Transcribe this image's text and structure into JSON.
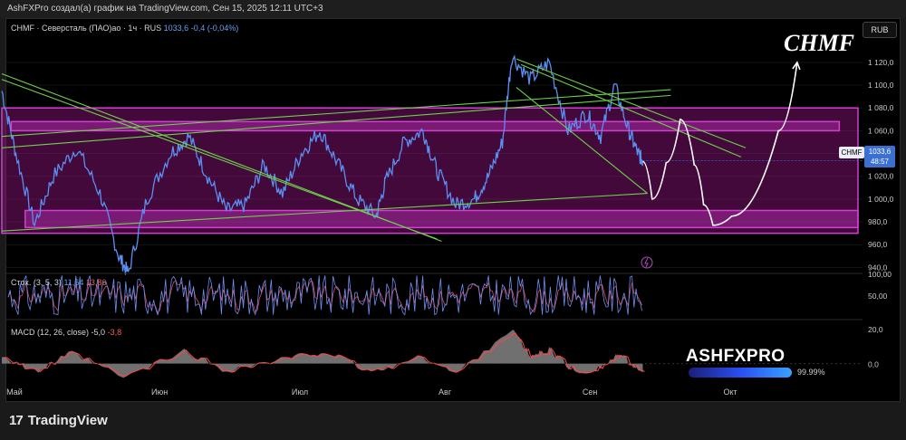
{
  "header": {
    "attribution": "AshFXPro создал(а) график на TradingView.com, Сен 15, 2025 12:11 UTC+3"
  },
  "legend": {
    "symbol": "CHMF · Северсталь (ПАО)ао · 1ч · RUS",
    "last": "1033,6",
    "change": "-0,4 (-0,04%)"
  },
  "currency_button": "RUB",
  "price_label": {
    "symbol": "CHMF",
    "price": "1033,6",
    "countdown": "48:57"
  },
  "annotation": "CHMF",
  "stoch_legend": {
    "name": "Стох. (3, 5, 3)",
    "k": "11,64",
    "d": "13,86"
  },
  "macd_legend": {
    "name": "MACD (12, 26, close)",
    "macd": "-5,0",
    "signal": "-3,8"
  },
  "watermark": {
    "brand": "ASHFXPRO",
    "progress_label": "99.99%",
    "progress": 0.9999
  },
  "footer_brand": "TradingView",
  "colors": {
    "price_line": "#5b8ff2",
    "zone": "#d23fd2",
    "trendline": "#6cd24a",
    "stoch_k": "#6b8ff0",
    "stoch_d": "#e04a6a",
    "macd_area": "#8a8a8a",
    "macd_signal": "#ff4444",
    "background": "#000000"
  },
  "chart_data": [
    {
      "type": "line",
      "title": "CHMF · Северсталь (ПАО)ао · 1ч · RUS",
      "x_ticks": [
        "Май",
        "Июн",
        "Июл",
        "Авг",
        "Сен",
        "Окт"
      ],
      "y_ticks": [
        940,
        960,
        980,
        1000,
        1020,
        1040,
        1060,
        1080,
        1100,
        1120
      ],
      "ylim": [
        930,
        1135
      ],
      "anchors": [
        [
          "2025-05-01",
          1095
        ],
        [
          "2025-05-04",
          1040
        ],
        [
          "2025-05-08",
          978
        ],
        [
          "2025-05-12",
          1020
        ],
        [
          "2025-05-17",
          1045
        ],
        [
          "2025-05-22",
          1005
        ],
        [
          "2025-05-26",
          950
        ],
        [
          "2025-05-28",
          935
        ],
        [
          "2025-06-01",
          1000
        ],
        [
          "2025-06-06",
          1040
        ],
        [
          "2025-06-10",
          1055
        ],
        [
          "2025-06-14",
          1020
        ],
        [
          "2025-06-18",
          990
        ],
        [
          "2025-06-22",
          995
        ],
        [
          "2025-06-26",
          1030
        ],
        [
          "2025-06-30",
          1005
        ],
        [
          "2025-07-04",
          1040
        ],
        [
          "2025-07-08",
          1060
        ],
        [
          "2025-07-12",
          1030
        ],
        [
          "2025-07-16",
          1000
        ],
        [
          "2025-07-20",
          985
        ],
        [
          "2025-07-22",
          1015
        ],
        [
          "2025-07-26",
          1050
        ],
        [
          "2025-07-30",
          1060
        ],
        [
          "2025-08-02",
          1025
        ],
        [
          "2025-08-06",
          995
        ],
        [
          "2025-08-10",
          1000
        ],
        [
          "2025-08-13",
          1020
        ],
        [
          "2025-08-16",
          1050
        ],
        [
          "2025-08-18",
          1125
        ],
        [
          "2025-08-22",
          1105
        ],
        [
          "2025-08-26",
          1120
        ],
        [
          "2025-08-30",
          1060
        ],
        [
          "2025-09-03",
          1075
        ],
        [
          "2025-09-06",
          1055
        ],
        [
          "2025-09-09",
          1100
        ],
        [
          "2025-09-12",
          1060
        ],
        [
          "2025-09-14",
          1040
        ],
        [
          "2025-09-15",
          1033.6
        ]
      ],
      "zones": [
        {
          "from": 970,
          "to": 1080,
          "x_from": "2025-05-01",
          "x_to": "2025-10-31"
        },
        {
          "from": 1060,
          "to": 1068,
          "x_from": "2025-05-03",
          "x_to": "2025-10-27"
        },
        {
          "from": 975,
          "to": 990,
          "x_from": "2025-05-06",
          "x_to": "2025-10-31"
        }
      ],
      "trendlines": [
        {
          "from": [
            "2025-05-01",
            1105
          ],
          "to": [
            "2025-08-02",
            965
          ]
        },
        {
          "from": [
            "2025-05-01",
            1110
          ],
          "to": [
            "2025-08-03",
            963
          ]
        },
        {
          "from": [
            "2025-05-01",
            972
          ],
          "to": [
            "2025-09-16",
            1005
          ]
        },
        {
          "from": [
            "2025-05-01",
            1055
          ],
          "to": [
            "2025-09-21",
            1096
          ]
        },
        {
          "from": [
            "2025-05-01",
            1045
          ],
          "to": [
            "2025-09-21",
            1091
          ]
        },
        {
          "from": [
            "2025-08-19",
            1123
          ],
          "to": [
            "2025-10-07",
            1045
          ]
        },
        {
          "from": [
            "2025-08-20",
            1118
          ],
          "to": [
            "2025-10-06",
            1037
          ]
        },
        {
          "from": [
            "2025-08-19",
            1098
          ],
          "to": [
            "2025-09-16",
            1005
          ]
        }
      ],
      "forecast": [
        [
          "2025-09-15",
          1033
        ],
        [
          "2025-09-17",
          1000
        ],
        [
          "2025-09-20",
          1032
        ],
        [
          "2025-09-23",
          1070
        ],
        [
          "2025-09-26",
          1030
        ],
        [
          "2025-09-28",
          995
        ],
        [
          "2025-09-30",
          977
        ],
        [
          "2025-10-04",
          985
        ],
        [
          "2025-10-14",
          1060
        ],
        [
          "2025-10-18",
          1120
        ]
      ]
    },
    {
      "type": "line",
      "title": "Стох. (3, 5, 3)",
      "y_ticks": [
        50,
        100
      ],
      "ylim": [
        0,
        100
      ],
      "series": [
        {
          "name": "%K",
          "last": 11.64
        },
        {
          "name": "%D",
          "last": 13.86
        }
      ]
    },
    {
      "type": "area",
      "title": "MACD (12, 26, close)",
      "y_ticks": [
        0,
        20
      ],
      "ylim": [
        -12,
        24
      ],
      "series": [
        {
          "name": "MACD",
          "last": -5.0
        },
        {
          "name": "Signal",
          "last": -3.8
        }
      ],
      "anchors": [
        [
          "2025-05-01",
          5
        ],
        [
          "2025-05-08",
          -5
        ],
        [
          "2025-05-16",
          6
        ],
        [
          "2025-05-27",
          -8
        ],
        [
          "2025-06-09",
          7
        ],
        [
          "2025-06-18",
          -4
        ],
        [
          "2025-07-01",
          3
        ],
        [
          "2025-07-09",
          7
        ],
        [
          "2025-07-19",
          -5
        ],
        [
          "2025-07-30",
          4
        ],
        [
          "2025-08-06",
          -6
        ],
        [
          "2025-08-18",
          20
        ],
        [
          "2025-08-22",
          4
        ],
        [
          "2025-08-26",
          8
        ],
        [
          "2025-09-01",
          -6
        ],
        [
          "2025-09-06",
          -2
        ],
        [
          "2025-09-10",
          5
        ],
        [
          "2025-09-15",
          -5
        ]
      ]
    }
  ]
}
